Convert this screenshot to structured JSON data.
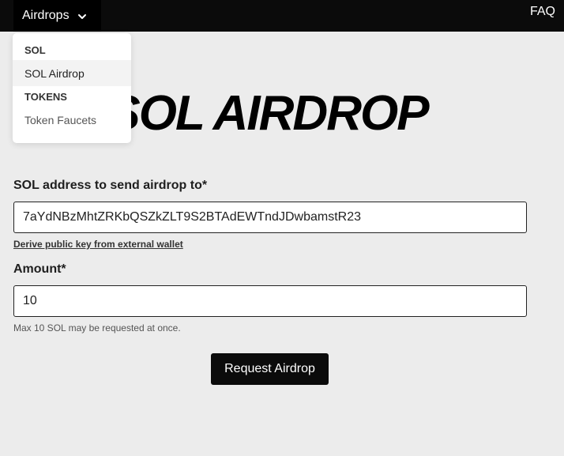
{
  "header": {
    "dropdown_label": "Airdrops",
    "dropdown_icon": "chevron-down-icon",
    "faq_label": "FAQ"
  },
  "menu": {
    "groups": [
      {
        "title": "SOL",
        "items": [
          {
            "label": "SOL Airdrop"
          }
        ]
      },
      {
        "title": "TOKENS",
        "items": [
          {
            "label": "Token Faucets"
          }
        ]
      }
    ]
  },
  "main": {
    "title": "SOL AIRDROP",
    "address_label": "SOL address to send airdrop to*",
    "address_value": "7aYdNBzMhtZRKbQSZkZLT9S2BTAdEWTndJDwbamstR23",
    "derive_link": "Derive public key from external wallet",
    "amount_label": "Amount*",
    "amount_value": "10",
    "amount_hint": "Max 10 SOL may be requested at once.",
    "submit_label": "Request Airdrop"
  },
  "colors": {
    "background": "#ececec",
    "topbar": "#0b0b0b",
    "button": "#0b0b0b"
  }
}
